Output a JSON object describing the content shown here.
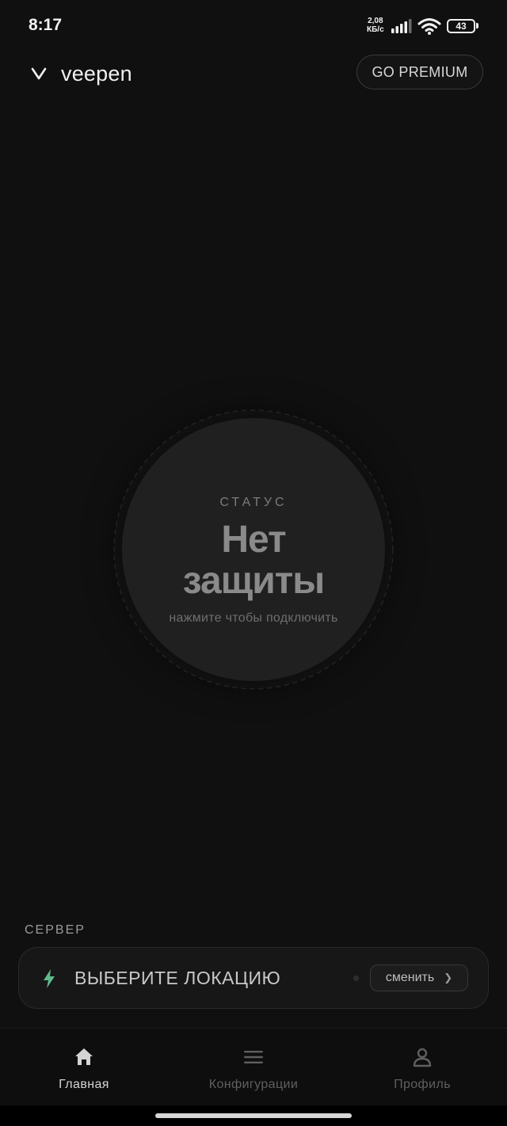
{
  "status_bar": {
    "time": "8:17",
    "net_speed_value": "2,08",
    "net_speed_unit": "КБ/с",
    "battery": "43"
  },
  "header": {
    "brand": "veepen",
    "premium_label": "GO PREMIUM"
  },
  "connect": {
    "status_label": "СТАТУС",
    "status_line1": "Нет",
    "status_line2": "защиты",
    "hint": "нажмите чтобы подключить"
  },
  "server": {
    "section_label": "СЕРВЕР",
    "location_title": "ВЫБЕРИТЕ ЛОКАЦИЮ",
    "change_label": "сменить",
    "change_icon": "chevron-right-icon"
  },
  "nav": {
    "items": [
      {
        "label": "Главная",
        "icon": "home-icon",
        "active": true
      },
      {
        "label": "Конфигурации",
        "icon": "menu-icon",
        "active": false
      },
      {
        "label": "Профиль",
        "icon": "user-icon",
        "active": false
      }
    ]
  },
  "colors": {
    "background": "#101010",
    "accent_green": "#5fb98a",
    "text_primary": "#e8e8e8",
    "text_muted": "#7b7b7b"
  }
}
